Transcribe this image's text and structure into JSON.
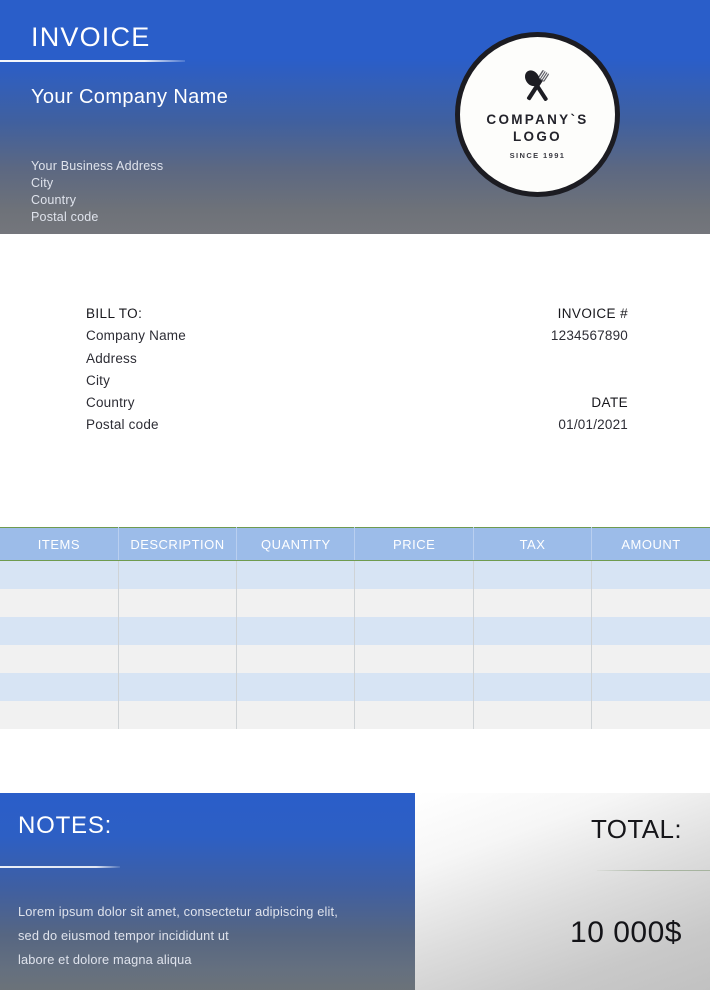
{
  "header": {
    "title": "INVOICE",
    "company_name": "Your Company Name",
    "address": {
      "line1": "Your Business Address",
      "line2": "City",
      "line3": "Country",
      "line4": "Postal code"
    },
    "logo": {
      "icon": "crossed-fork-and-spoon-icon",
      "name_line1": "COMPANY`S",
      "name_line2": "LOGO",
      "since": "SINCE 1991"
    }
  },
  "bill_to": {
    "label": "BILL TO:",
    "company_name": "Company Name",
    "address": "Address",
    "city": "City",
    "country": "Country",
    "postal_code": "Postal code"
  },
  "meta": {
    "invoice_number_label": "INVOICE #",
    "invoice_number": "1234567890",
    "date_label": "DATE",
    "date": "01/01/2021"
  },
  "table": {
    "columns": [
      "ITEMS",
      "DESCRIPTION",
      "QUANTITY",
      "PRICE",
      "TAX",
      "AMOUNT"
    ],
    "rows": [
      [
        "",
        "",
        "",
        "",
        "",
        ""
      ],
      [
        "",
        "",
        "",
        "",
        "",
        ""
      ],
      [
        "",
        "",
        "",
        "",
        "",
        ""
      ],
      [
        "",
        "",
        "",
        "",
        "",
        ""
      ],
      [
        "",
        "",
        "",
        "",
        "",
        ""
      ],
      [
        "",
        "",
        "",
        "",
        "",
        ""
      ]
    ]
  },
  "notes": {
    "title": "NOTES:",
    "line1": "Lorem ipsum dolor sit amet, consectetur adipiscing elit,",
    "line2": "sed do eiusmod tempor incididunt ut",
    "line3": "labore et dolore magna aliqua"
  },
  "total": {
    "label": "TOTAL:",
    "amount": "10 000$"
  },
  "colors": {
    "brand_blue": "#2a5ec9",
    "header_gradient_end": "#74767c",
    "table_header_blue": "#9cbce9",
    "table_row_blue": "#d7e4f4",
    "table_row_gray": "#f1f1f1",
    "table_header_border_green": "#6f9b4f",
    "text_dark": "#2d2d35",
    "text_light": "#dfe3ec"
  }
}
